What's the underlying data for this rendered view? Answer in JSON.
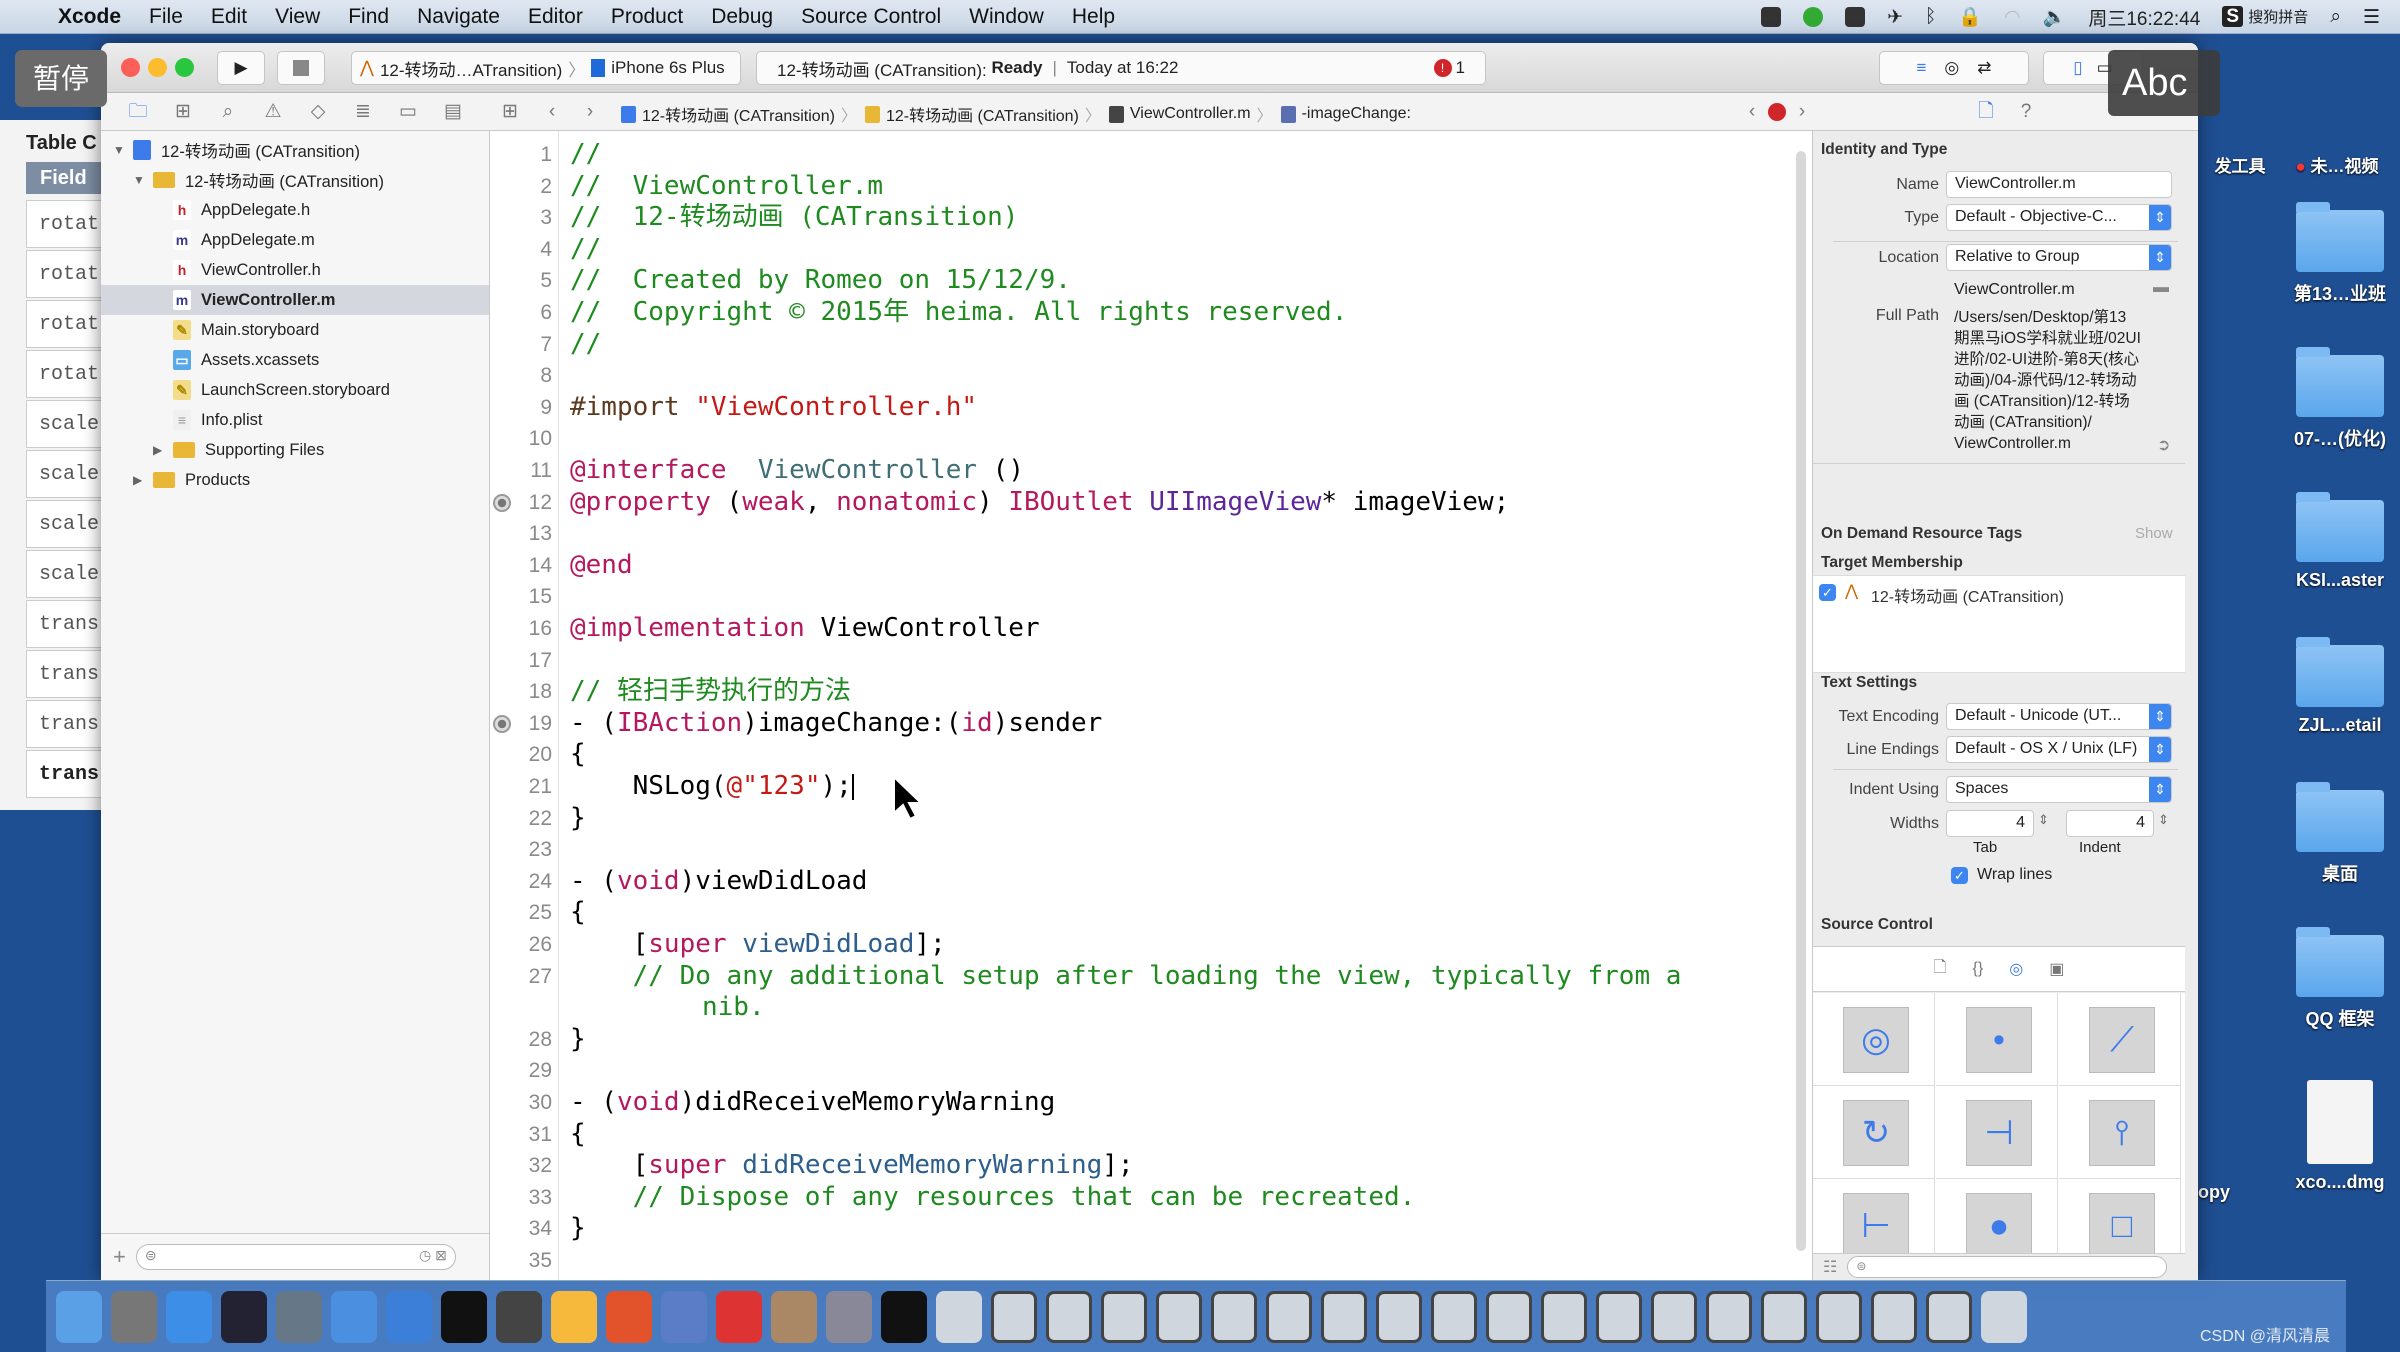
{
  "menubar": {
    "app": "Xcode",
    "items": [
      "File",
      "Edit",
      "View",
      "Find",
      "Navigate",
      "Editor",
      "Product",
      "Debug",
      "Source Control",
      "Window",
      "Help"
    ],
    "clock": "周三16:22:44",
    "input_method": "搜狗拼音"
  },
  "overlays": {
    "pause": "暂停",
    "ime": "Abc"
  },
  "background_window": {
    "title": "Table C",
    "header": "Field",
    "cells": [
      "rotat",
      "rotat",
      "rotat",
      "rotat",
      "scale",
      "scale",
      "scale",
      "scale",
      "trans",
      "trans",
      "trans",
      "transla"
    ]
  },
  "toolbar": {
    "scheme": "12-转场动…ATransition)",
    "device": "iPhone 6s Plus",
    "activity_project": "12-转场动画 (CATransition):",
    "activity_status": "Ready",
    "activity_time": "Today at 16:22",
    "error_count": "1"
  },
  "jumpbar": [
    "12-转场动画 (CATransition)",
    "12-转场动画 (CATransition)",
    "ViewController.m",
    "-imageChange:"
  ],
  "navigator": {
    "items": [
      {
        "label": "12-转场动画 (CATransition)",
        "icon": "project",
        "level": 0,
        "disclosure": "open"
      },
      {
        "label": "12-转场动画 (CATransition)",
        "icon": "folder",
        "level": 1,
        "disclosure": "open"
      },
      {
        "label": "AppDelegate.h",
        "icon": "h",
        "level": 2
      },
      {
        "label": "AppDelegate.m",
        "icon": "m",
        "level": 2
      },
      {
        "label": "ViewController.h",
        "icon": "h",
        "level": 2
      },
      {
        "label": "ViewController.m",
        "icon": "m",
        "level": 2,
        "selected": true
      },
      {
        "label": "Main.storyboard",
        "icon": "storyboard",
        "level": 2
      },
      {
        "label": "Assets.xcassets",
        "icon": "assets",
        "level": 2
      },
      {
        "label": "LaunchScreen.storyboard",
        "icon": "storyboard",
        "level": 2
      },
      {
        "label": "Info.plist",
        "icon": "plist",
        "level": 2
      },
      {
        "label": "Supporting Files",
        "icon": "folder",
        "level": 2,
        "disclosure": "closed"
      },
      {
        "label": "Products",
        "icon": "folder",
        "level": 1,
        "disclosure": "closed"
      }
    ]
  },
  "editor": {
    "breakpoint_lines": [
      12,
      19
    ],
    "cursor_line": 21,
    "lines": [
      {
        "n": 1,
        "t": [
          [
            "com",
            "//"
          ]
        ]
      },
      {
        "n": 2,
        "t": [
          [
            "com",
            "//  ViewController.m"
          ]
        ]
      },
      {
        "n": 3,
        "t": [
          [
            "com",
            "//  12-转场动画 (CATransition)"
          ]
        ]
      },
      {
        "n": 4,
        "t": [
          [
            "com",
            "//"
          ]
        ]
      },
      {
        "n": 5,
        "t": [
          [
            "com",
            "//  Created by Romeo on 15/12/9."
          ]
        ]
      },
      {
        "n": 6,
        "t": [
          [
            "com",
            "//  Copyright © 2015年 heima. All rights reserved."
          ]
        ]
      },
      {
        "n": 7,
        "t": [
          [
            "com",
            "//"
          ]
        ]
      },
      {
        "n": 8,
        "t": []
      },
      {
        "n": 9,
        "t": [
          [
            "pp",
            "#import "
          ],
          [
            "str",
            "\"ViewController.h\""
          ]
        ]
      },
      {
        "n": 10,
        "t": []
      },
      {
        "n": 11,
        "t": [
          [
            "kw",
            "@interface"
          ],
          [
            "",
            "  "
          ],
          [
            "cls",
            "ViewController"
          ],
          [
            "",
            " ()"
          ]
        ]
      },
      {
        "n": 12,
        "t": [
          [
            "kw",
            "@property"
          ],
          [
            "",
            " ("
          ],
          [
            "kw",
            "weak"
          ],
          [
            "",
            ", "
          ],
          [
            "kw",
            "nonatomic"
          ],
          [
            "",
            ") "
          ],
          [
            "kw",
            "IBOutlet"
          ],
          [
            "",
            " "
          ],
          [
            "type",
            "UIImageView"
          ],
          [
            "",
            "* imageView;"
          ]
        ]
      },
      {
        "n": 13,
        "t": []
      },
      {
        "n": 14,
        "t": [
          [
            "kw",
            "@end"
          ]
        ]
      },
      {
        "n": 15,
        "t": []
      },
      {
        "n": 16,
        "t": [
          [
            "kw",
            "@implementation"
          ],
          [
            "",
            " ViewController"
          ]
        ]
      },
      {
        "n": 17,
        "t": []
      },
      {
        "n": 18,
        "t": [
          [
            "com",
            "// 轻扫手势执行的方法"
          ]
        ]
      },
      {
        "n": 19,
        "t": [
          [
            "",
            "- ("
          ],
          [
            "kw",
            "IBAction"
          ],
          [
            "",
            ")imageChange:("
          ],
          [
            "kw",
            "id"
          ],
          [
            "",
            ")sender"
          ]
        ]
      },
      {
        "n": 20,
        "t": [
          [
            "",
            "{"
          ]
        ]
      },
      {
        "n": 21,
        "t": [
          [
            "",
            "    NSLog("
          ],
          [
            "str",
            "@\"123\""
          ],
          [
            "",
            ");"
          ]
        ]
      },
      {
        "n": 22,
        "t": [
          [
            "",
            "}"
          ]
        ]
      },
      {
        "n": 23,
        "t": []
      },
      {
        "n": 24,
        "t": [
          [
            "",
            "- ("
          ],
          [
            "kw",
            "void"
          ],
          [
            "",
            ")viewDidLoad"
          ]
        ]
      },
      {
        "n": 25,
        "t": [
          [
            "",
            "{"
          ]
        ]
      },
      {
        "n": 26,
        "t": [
          [
            "",
            "    ["
          ],
          [
            "kw",
            "super"
          ],
          [
            "",
            " "
          ],
          [
            "meth",
            "viewDidLoad"
          ],
          [
            "",
            "];"
          ]
        ]
      },
      {
        "n": 27,
        "t": [
          [
            "",
            "    "
          ],
          [
            "com",
            "// Do any additional setup after loading the view, typically from a"
          ]
        ],
        "cont": "nib."
      },
      {
        "n": 28,
        "t": [
          [
            "",
            "}"
          ]
        ]
      },
      {
        "n": 29,
        "t": []
      },
      {
        "n": 30,
        "t": [
          [
            "",
            "- ("
          ],
          [
            "kw",
            "void"
          ],
          [
            "",
            ")didReceiveMemoryWarning"
          ]
        ]
      },
      {
        "n": 31,
        "t": [
          [
            "",
            "{"
          ]
        ]
      },
      {
        "n": 32,
        "t": [
          [
            "",
            "    ["
          ],
          [
            "kw",
            "super"
          ],
          [
            "",
            " "
          ],
          [
            "meth",
            "didReceiveMemoryWarning"
          ],
          [
            "",
            "];"
          ]
        ]
      },
      {
        "n": 33,
        "t": [
          [
            "",
            "    "
          ],
          [
            "com",
            "// Dispose of any resources that can be recreated."
          ]
        ]
      },
      {
        "n": 34,
        "t": [
          [
            "",
            "}"
          ]
        ]
      },
      {
        "n": 35,
        "t": []
      }
    ]
  },
  "inspector": {
    "identity_header": "Identity and Type",
    "name_label": "Name",
    "name_value": "ViewController.m",
    "type_label": "Type",
    "type_value": "Default - Objective-C...",
    "location_label": "Location",
    "location_value": "Relative to Group",
    "location_file": "ViewController.m",
    "full_path_label": "Full Path",
    "full_path_lines": [
      "/Users/sen/Desktop/第13",
      "期黑马iOS学科就业班/02UI",
      "进阶/02-UI进阶-第8天(核心",
      "动画)/04-源代码/12-转场动",
      "画 (CATransition)/12-转场",
      "动画 (CATransition)/",
      "ViewController.m"
    ],
    "odr_header": "On Demand Resource Tags",
    "odr_show": "Show",
    "target_header": "Target Membership",
    "target_item": "12-转场动画 (CATransition)",
    "text_header": "Text Settings",
    "encoding_label": "Text Encoding",
    "encoding_value": "Default - Unicode (UT...",
    "endings_label": "Line Endings",
    "endings_value": "Default - OS X / Unix (LF)",
    "indent_label": "Indent Using",
    "indent_value": "Spaces",
    "widths_label": "Widths",
    "tab_value": "4",
    "indent_width_value": "4",
    "tab_caption": "Tab",
    "indent_caption": "Indent",
    "wrap_label": "Wrap lines",
    "wrap_checked": true,
    "source_header": "Source Control",
    "library_icons": [
      "compass-icon",
      "tap-icon",
      "pinch-icon",
      "rotation-icon",
      "swipe-icon",
      "pan-icon",
      "screen-edge-pan-icon",
      "long-press-icon",
      "custom-gesture-icon"
    ]
  },
  "desktop": {
    "top_labels": [
      "发工具",
      "未…视频"
    ],
    "icons": [
      "第13…业班",
      "07-…(优化)",
      "KSI...aster",
      "ZJL...etail",
      "桌面",
      "QQ 框架",
      "xco....dmg"
    ],
    "partial_label": "opy",
    "watermark": "CSDN @清风清晨"
  },
  "dock": {
    "count": 36
  }
}
